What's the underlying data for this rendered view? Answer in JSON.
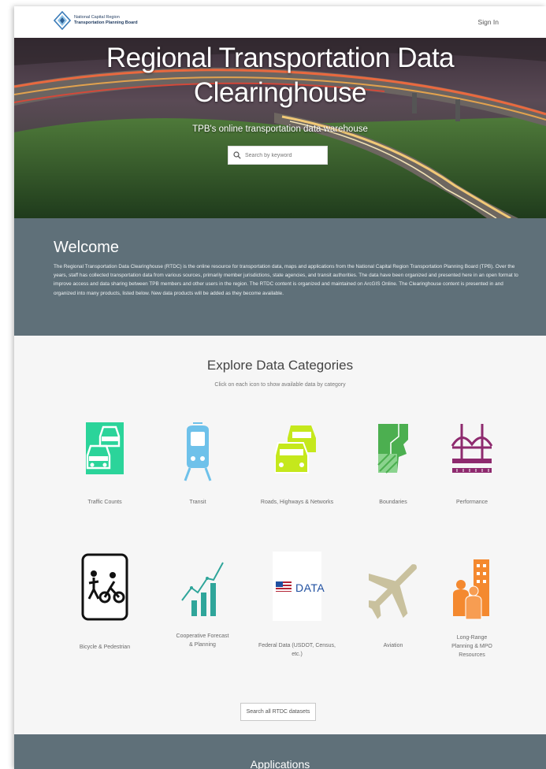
{
  "header": {
    "logo_line1": "National Capital Region",
    "logo_line2": "Transportation Planning Board",
    "signin_label": "Sign In"
  },
  "hero": {
    "title_line1": "Regional Transportation Data",
    "title_line2": "Clearinghouse",
    "subtitle": "TPB's online transportation data warehouse",
    "search_placeholder": "Search by keyword"
  },
  "welcome": {
    "heading": "Welcome",
    "body": "The Regional Transportation Data Clearinghouse (RTDC) is the online resource for transportation data, maps and applications from the National Capital Region Transportation Planning Board (TPB). Over the years, staff has collected transportation data from various sources, primarily member jurisdictions, state agencies, and transit authorities. The data have been organized and presented here in an open format to improve access and data sharing between TPB members and other users in the region. The RTDC content is organized and maintained on ArcGIS Online. The Clearinghouse content is presented in and organized into many products, listed below. New data products will be added as they become available."
  },
  "explore": {
    "title": "Explore Data Categories",
    "subtitle": "Click on each icon to show available data by category",
    "categories": [
      {
        "label": "Traffic Counts",
        "icon": "traffic-counts-icon",
        "color": "#2bd49a"
      },
      {
        "label": "Transit",
        "icon": "transit-icon",
        "color": "#6ec1ea"
      },
      {
        "label": "Roads, Highways & Networks",
        "icon": "roads-icon",
        "color": "#c5e81c"
      },
      {
        "label": "Boundaries",
        "icon": "boundaries-icon",
        "color": "#4caf50"
      },
      {
        "label": "Performance",
        "icon": "performance-icon",
        "color": "#8e2a6e"
      },
      {
        "label": "Bicycle & Pedestrian",
        "icon": "bicycle-pedestrian-icon",
        "color": "#111111"
      },
      {
        "label": "Cooperative Forecast & Planning",
        "icon": "forecast-icon",
        "color": "#2fa59a"
      },
      {
        "label": "Federal Data (USDOT, Census, etc.)",
        "icon": "federal-data-icon",
        "color": "#1f4fa0",
        "badge": "DATA"
      },
      {
        "label": "Aviation",
        "icon": "aviation-icon",
        "color": "#c9c19e"
      },
      {
        "label": "Long-Range Planning & MPO Resources",
        "icon": "long-range-planning-icon",
        "color": "#f4892f"
      }
    ],
    "search_all_label": "Search all RTDC datasets"
  },
  "applications": {
    "heading": "Applications"
  }
}
